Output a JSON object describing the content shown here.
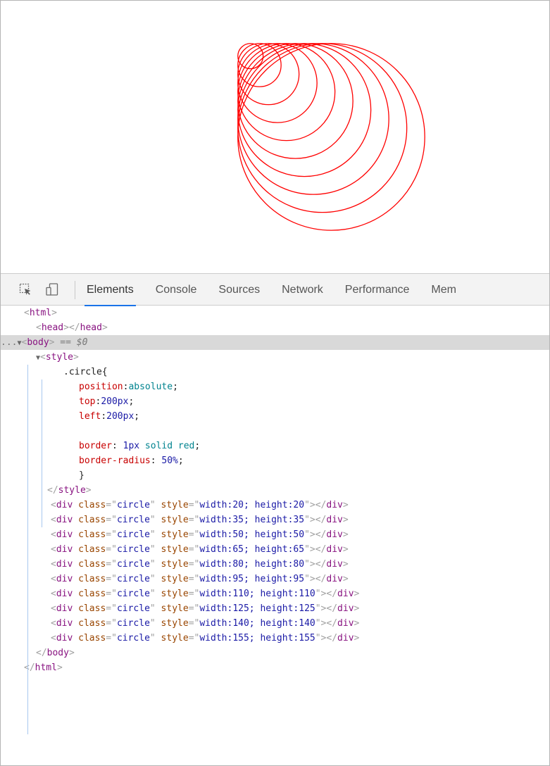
{
  "viewport": {
    "circle_color": "#ff0000",
    "circle_sizes": [
      20,
      35,
      50,
      65,
      80,
      95,
      110,
      125,
      140,
      155
    ]
  },
  "devtools": {
    "icons": [
      "inspect-icon",
      "device-toolbar-icon"
    ],
    "tabs": [
      {
        "label": "Elements",
        "active": true
      },
      {
        "label": "Console",
        "active": false
      },
      {
        "label": "Sources",
        "active": false
      },
      {
        "label": "Network",
        "active": false
      },
      {
        "label": "Performance",
        "active": false
      },
      {
        "label": "Mem",
        "active": false
      }
    ],
    "accent": "#1a73e8",
    "dom": {
      "html_open": "<html>",
      "head": "<head></head>",
      "ellipsis": "...",
      "body_triangle": "▼",
      "body_open": "<body>",
      "body_eq": " == $0",
      "style_triangle": "▼",
      "style_open": "<style>",
      "selector": ".circle{",
      "decls": [
        {
          "prop": "position",
          "sep": ":",
          "value": "absolute",
          "kind": "kw",
          "end": ";"
        },
        {
          "prop": "top",
          "sep": ":",
          "value": "200px",
          "kind": "num",
          "end": ";"
        },
        {
          "prop": "left",
          "sep": ":",
          "value": "200px",
          "kind": "num",
          "end": ";"
        },
        {
          "blank": true
        },
        {
          "prop": "border",
          "sep": ": ",
          "value": "1px solid red",
          "kind": "mixed",
          "end": ";"
        },
        {
          "prop": "border-radius",
          "sep": ": ",
          "value": "50%",
          "kind": "num",
          "end": ";"
        }
      ],
      "close_brace": "}",
      "style_close": "</style>",
      "divs": [
        {
          "class": "circle",
          "style": "width:20; height:20"
        },
        {
          "class": "circle",
          "style": "width:35; height:35"
        },
        {
          "class": "circle",
          "style": "width:50; height:50"
        },
        {
          "class": "circle",
          "style": "width:65; height:65"
        },
        {
          "class": "circle",
          "style": "width:80; height:80"
        },
        {
          "class": "circle",
          "style": "width:95; height:95"
        },
        {
          "class": "circle",
          "style": "width:110; height:110"
        },
        {
          "class": "circle",
          "style": "width:125; height:125"
        },
        {
          "class": "circle",
          "style": "width:140; height:140"
        },
        {
          "class": "circle",
          "style": "width:155; height:155"
        }
      ],
      "body_close": "</body>",
      "html_close": "</html>"
    }
  }
}
